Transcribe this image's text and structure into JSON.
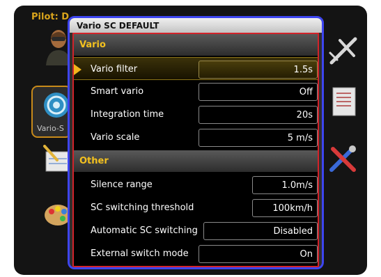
{
  "background": {
    "pilot_label": "Pilot: D",
    "vario_card_label": "Vario-S"
  },
  "dialog": {
    "title": "Vario SC DEFAULT",
    "sections": [
      {
        "header": "Vario",
        "rows": [
          {
            "label": "Vario filter",
            "value": "1.5s",
            "selected": true
          },
          {
            "label": "Smart vario",
            "value": "Off"
          },
          {
            "label": "Integration time",
            "value": "20s"
          },
          {
            "label": "Vario scale",
            "value": "5 m/s"
          }
        ]
      },
      {
        "header": "Other",
        "rows": [
          {
            "label": "Silence range",
            "value": "1.0m/s"
          },
          {
            "label": "SC switching threshold",
            "value": "100km/h"
          },
          {
            "label": "Automatic SC switching",
            "value": "Disabled"
          },
          {
            "label": "External switch mode",
            "value": "On"
          }
        ]
      }
    ]
  },
  "colors": {
    "accent": "#f3c11f",
    "dialog_border": "#3d45f0",
    "body_border": "#d2232a"
  },
  "icons": [
    "pilot-icon",
    "glider-icon",
    "vario-icon",
    "logbook-icon",
    "notepad-icon",
    "tools-icon",
    "palette-icon"
  ]
}
